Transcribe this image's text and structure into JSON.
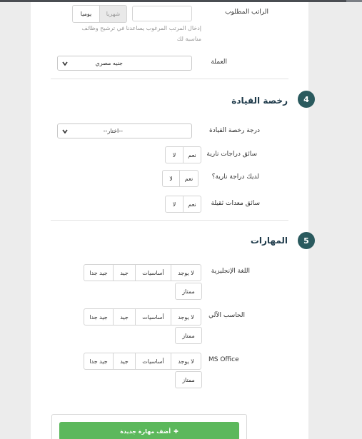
{
  "salary": {
    "label": "الراتب المطلوب",
    "input_value": "",
    "periods": [
      "يوميا",
      "شهريا"
    ],
    "selected_period": "شهريا",
    "hint_line1": "إدخال المرتب المرغوب يساعدنا في ترشيح وظائف",
    "hint_line2": "مناسبة لك"
  },
  "currency": {
    "label": "العملة",
    "value": "جنيه مصري"
  },
  "license_section": {
    "number": "4",
    "title": "رخصة القيادة"
  },
  "license": {
    "degree_label": "درجة رخصة القيادة",
    "degree_value": "--اختار--",
    "bike_driver_label": "سائق دراجات نارية",
    "has_bike_label": "لديك دراجة نارية؟",
    "heavy_label": "سائق معدات ثقيلة",
    "yes": "نعم",
    "no": "لا"
  },
  "skills_section": {
    "number": "5",
    "title": "المهارات"
  },
  "skills": [
    {
      "name": "اللغة الإنجليزية",
      "levels": [
        "جيد جدا",
        "جيد",
        "أساسيات",
        "لا يوجد"
      ],
      "extra": "ممتاز"
    },
    {
      "name": "الحاسب الآلي",
      "levels": [
        "جيد جدا",
        "جيد",
        "أساسيات",
        "لا يوجد"
      ],
      "extra": "ممتاز"
    },
    {
      "name": "MS Office",
      "levels": [
        "جيد جدا",
        "جيد",
        "أساسيات",
        "لا يوجد"
      ],
      "extra": "ممتاز"
    }
  ],
  "add_skill": {
    "icon": "plus-icon",
    "label": "أضف مهارة جديدة"
  },
  "colors": {
    "accent_green": "#5cb85c",
    "section_badge": "#2a5a5e",
    "heading": "#1e3a4a"
  }
}
